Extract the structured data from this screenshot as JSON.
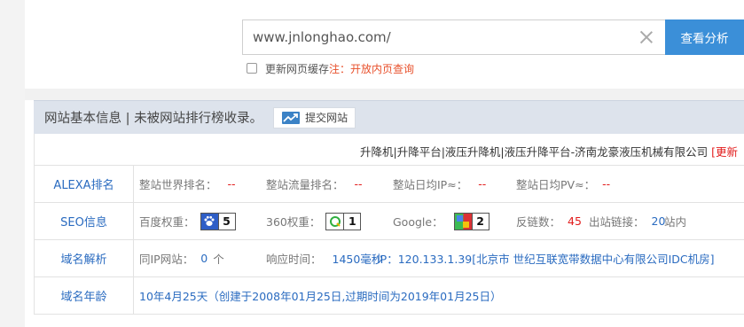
{
  "search": {
    "value": "www.jnlonghao.com/",
    "button_label": "查看分析"
  },
  "cache": {
    "label": "更新网页缓存",
    "note": "注：开放内页查询"
  },
  "info": {
    "title": "网站基本信息 | 未被网站排行榜收录。",
    "submit_label": "提交网站",
    "site_title": "升降机|升降平台|液压升降机|液压升降平台-济南龙豪液压机械有限公司",
    "site_title_tag": "[更新"
  },
  "alexa": {
    "label": "ALEXA排名",
    "world_rank_label": "整站世界排名：",
    "world_rank": "--",
    "traffic_rank_label": "整站流量排名：",
    "traffic_rank": "--",
    "daily_ip_label": "整站日均IP≈：",
    "daily_ip": "--",
    "daily_pv_label": "整站日均PV≈：",
    "daily_pv": "--"
  },
  "seo": {
    "label": "SEO信息",
    "baidu_label": "百度权重：",
    "baidu_weight": "5",
    "s360_label": "360权重：",
    "s360_weight": "1",
    "google_label": "Google：",
    "google_weight": "2",
    "backlinks_label": "反链数：",
    "backlinks": "45",
    "outlinks_label": "出站链接：",
    "outlinks": "20",
    "inlinks_label": "站内"
  },
  "dns": {
    "label": "域名解析",
    "same_ip_label": "同IP网站：",
    "same_ip_count": "0",
    "same_ip_unit": "个",
    "response_label": "响应时间：",
    "response_time": "1450毫秒",
    "ip_text": "IP：120.133.1.39[北京市 世纪互联宽带数据中心有限公司IDC机房]"
  },
  "age": {
    "label": "域名年龄",
    "text": "10年4月25天（创建于2008年01月25日,过期时间为2019年01月25日）"
  },
  "colors": {
    "accent": "#3b8fd8",
    "link": "#2a6bc0",
    "alert": "#e21b1b",
    "header_bg": "#dde3ec"
  }
}
